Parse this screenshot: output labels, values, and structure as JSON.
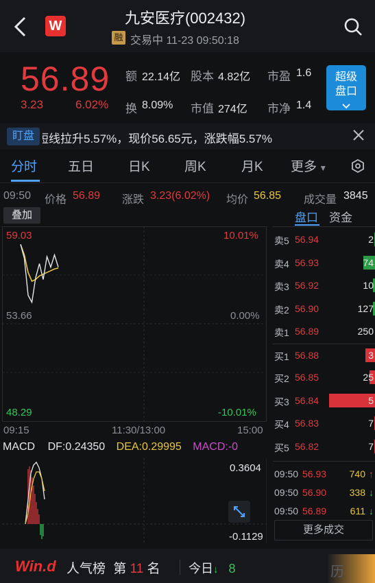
{
  "header": {
    "title": "九安医疗(002432)",
    "logo_letter": "W",
    "margin_badge": "融",
    "status": "交易中 11-23 09:50:18"
  },
  "quote": {
    "price": "56.89",
    "change": "3.23",
    "change_pct": "6.02%",
    "turnover_label": "额",
    "turnover": "22.14亿",
    "share_capital_label": "股本",
    "share_capital": "4.82亿",
    "pe_label": "市盈",
    "pe": "1.6",
    "turnover_rate_label": "换",
    "turnover_rate": "8.09%",
    "market_cap_label": "市值",
    "market_cap": "274亿",
    "pb_label": "市净",
    "pb": "1.4",
    "super_button_line1": "超级",
    "super_button_line2": "盘口"
  },
  "marquee": {
    "tag": "盯盘",
    "text": "短线拉升5.57%，现价56.65元，涨跌幅5.57%"
  },
  "tabs": [
    "分时",
    "五日",
    "日K",
    "周K",
    "月K",
    "更多"
  ],
  "info_row": {
    "time": "09:50",
    "price_label": "价格",
    "price": "56.89",
    "change_label": "涨跌",
    "change": "3.23(6.02%)",
    "avg_label": "均价",
    "avg": "56.85",
    "volume_label": "成交量",
    "volume": "3845"
  },
  "chart": {
    "overlay_button": "叠加",
    "y_top": "59.03",
    "y_mid": "53.66",
    "y_bottom": "48.29",
    "pct_top": "10.01%",
    "pct_mid": "0.00%",
    "pct_bottom": "-10.01%",
    "x_start": "09:15",
    "x_mid": "11:30/13:00",
    "x_end": "15:00",
    "colors": {
      "price_line": "#e6e7ea",
      "avg_line": "#e8c740",
      "up": "#e23b3f",
      "down": "#34c759"
    }
  },
  "chart_data": {
    "type": "line",
    "ylim": [
      48.29,
      59.03
    ],
    "x_ticks": [
      "09:15",
      "11:30/13:00",
      "15:00"
    ],
    "series": [
      {
        "values": [
          58.2,
          57.4,
          55.3,
          54.9,
          56.3,
          57.1,
          56.2,
          57.5,
          56.9,
          57.6,
          56.9
        ]
      },
      {
        "values": [
          58.2,
          57.6,
          56.6,
          56.1,
          56.2,
          56.4,
          56.5,
          56.6,
          56.7,
          56.8,
          56.85
        ]
      }
    ]
  },
  "orderbook": {
    "tab_active": "盘口",
    "tab_other": "资金",
    "asks": [
      {
        "label": "卖5",
        "price": "56.94",
        "volume": "2",
        "bar": 0.01
      },
      {
        "label": "卖4",
        "price": "56.93",
        "volume": "74",
        "bar": 0.24
      },
      {
        "label": "卖3",
        "price": "56.92",
        "volume": "10",
        "bar": 0.04
      },
      {
        "label": "卖2",
        "price": "56.90",
        "volume": "127",
        "bar": 0.04
      },
      {
        "label": "卖1",
        "price": "56.89",
        "volume": "250",
        "bar": 0.0
      }
    ],
    "bids": [
      {
        "label": "买1",
        "price": "56.88",
        "volume": "3",
        "bar": 0.2
      },
      {
        "label": "买2",
        "price": "56.85",
        "volume": "25",
        "bar": 0.12
      },
      {
        "label": "买3",
        "price": "56.84",
        "volume": "5",
        "bar": 0.95
      },
      {
        "label": "买4",
        "price": "56.83",
        "volume": "7",
        "bar": 0.02
      },
      {
        "label": "买5",
        "price": "56.82",
        "volume": "7",
        "bar": 0.02
      }
    ]
  },
  "macd": {
    "name": "MACD",
    "df_label": "DF:",
    "df": "0.24350",
    "dea_label": "DEA:",
    "dea": "0.29995",
    "macd_label": "MACD:",
    "macd": "-0",
    "y_top": "0.3604",
    "y_bottom": "-0.1129"
  },
  "trades": [
    {
      "time": "09:50",
      "price": "56.93",
      "volume": "740",
      "dir": "up"
    },
    {
      "time": "09:50",
      "price": "56.90",
      "volume": "338",
      "dir": "down"
    },
    {
      "time": "09:50",
      "price": "56.89",
      "volume": "611",
      "dir": "down"
    }
  ],
  "more_trades": "更多成交",
  "footer": {
    "brand": "Win.d",
    "popularity_label": "人气榜",
    "rank_prefix": "第",
    "rank": "11",
    "rank_suffix": "名",
    "today_label": "今日",
    "today_value": "8",
    "corner_text": "历"
  }
}
